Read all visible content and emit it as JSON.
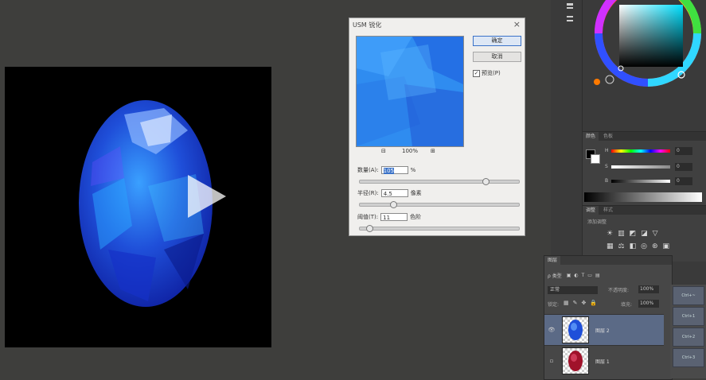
{
  "document": {
    "play_icon": "play-icon"
  },
  "usm_dialog": {
    "title": "USM 锐化",
    "close": "×",
    "ok_label": "确定",
    "cancel_label": "取消",
    "preview_label": "预览(P)",
    "preview_checked": true,
    "zoom_value": "100%",
    "zoom_out": "⊟",
    "zoom_in": "⊞",
    "amount_label": "数量(A):",
    "amount_value": "105",
    "amount_unit": "%",
    "amount_level": 0.8,
    "radius_label": "半径(R):",
    "radius_value": "4.5",
    "radius_unit": "像素",
    "radius_level": 0.2,
    "threshold_label": "阈值(T):",
    "threshold_value": "11",
    "threshold_unit": "色阶",
    "threshold_level": 0.04
  },
  "color_panel": {
    "tabs": [
      "颜色",
      "色板"
    ],
    "channels": [
      {
        "label": "H",
        "value": "0"
      },
      {
        "label": "S",
        "value": "0"
      },
      {
        "label": "B",
        "value": "0"
      }
    ]
  },
  "adjustments_panel": {
    "tabs": [
      "调整",
      "样式"
    ],
    "hint": "添加调整"
  },
  "layers_panel": {
    "tab": "图层",
    "filter_label": "ρ 类型",
    "blend_mode": "正常",
    "opacity_label": "不透明度:",
    "opacity_value": "100%",
    "lock_label": "锁定:",
    "fill_label": "填充:",
    "fill_value": "100%",
    "layers": [
      {
        "name": "图层 2",
        "visible": true,
        "selected": true
      },
      {
        "name": "图层 1",
        "visible": false,
        "selected": false
      }
    ]
  },
  "shortcuts": [
    "Ctrl+~",
    "Ctrl+1",
    "Ctrl+2",
    "Ctrl+3"
  ],
  "colors": {
    "dialog_bg": "#f0efed",
    "selection_blue": "#3a72c8",
    "layer_selected": "#5b6a86",
    "workspace": "#3e3e3c"
  }
}
